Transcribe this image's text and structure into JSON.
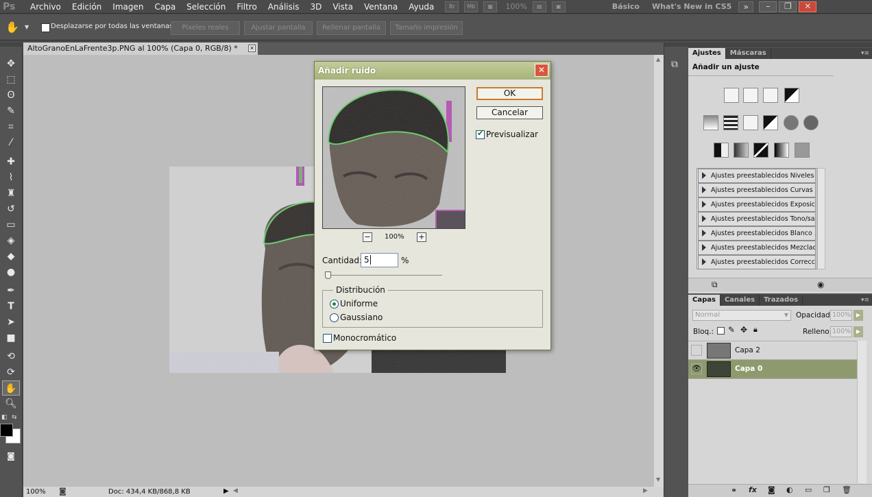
{
  "app": {
    "logo": "Ps"
  },
  "menu": [
    "Archivo",
    "Edición",
    "Imagen",
    "Capa",
    "Selección",
    "Filtro",
    "Análisis",
    "3D",
    "Vista",
    "Ventana",
    "Ayuda"
  ],
  "menubar": {
    "bridge_label": "Br",
    "minibridge_label": "Mb",
    "zoom_value": "100%",
    "workspace_basic": "Básico",
    "workspace_new": "What's New in CS5",
    "more_label": "»"
  },
  "options": {
    "scroll_all_label": "Desplazarse por todas las ventanas",
    "scroll_all_checked": false,
    "actual_pixels": "Píxeles reales",
    "fit_screen": "Ajustar pantalla",
    "fill_screen": "Rellenar pantalla",
    "print_size": "Tamaño impresión"
  },
  "document": {
    "tab_title": "AltoGranoEnLaFrente3p.PNG al 100% (Capa 0, RGB/8) *",
    "status_zoom": "100%",
    "status_doc": "Doc: 434,4 KB/868,8 KB"
  },
  "dialog": {
    "title": "Añadir ruido",
    "ok": "OK",
    "cancel": "Cancelar",
    "preview_label": "Previsualizar",
    "preview_checked": true,
    "preview_zoom": "100%",
    "zoom_out": "−",
    "zoom_in": "+",
    "amount_label": "Cantidad:",
    "amount_value": "5",
    "amount_unit": "%",
    "distribution_label": "Distribución",
    "uniform": "Uniforme",
    "gaussian": "Gaussiano",
    "distribution_selected": "Uniforme",
    "mono_label": "Monocromático",
    "mono_checked": false
  },
  "adjustments": {
    "tabs": [
      "Ajustes",
      "Máscaras"
    ],
    "active_tab": "Ajustes",
    "heading": "Añadir un ajuste",
    "presets": [
      "Ajustes preestablecidos Niveles",
      "Ajustes preestablecidos Curvas",
      "Ajustes preestablecidos Exposici...",
      "Ajustes preestablecidos Tono/sa...",
      "Ajustes preestablecidos Blanco ...",
      "Ajustes preestablecidos Mezclad...",
      "Ajustes preestablecidos Correcci..."
    ]
  },
  "layers": {
    "tabs": [
      "Capas",
      "Canales",
      "Trazados"
    ],
    "active_tab": "Capas",
    "blend_mode": "Normal",
    "opacity_label": "Opacidad:",
    "opacity_value": "100%",
    "lock_label": "Bloq.:",
    "fill_label": "Relleno:",
    "fill_value": "100%",
    "items": [
      {
        "name": "Capa 2",
        "visible": false,
        "selected": false
      },
      {
        "name": "Capa 0",
        "visible": true,
        "selected": true
      }
    ]
  },
  "colors": {
    "ui_dark": "#535353",
    "panel_light": "#d6d6d6",
    "dialog_title": "#a7b27a",
    "selected_layer": "#8e9a6e",
    "ok_border": "#c97b2e"
  }
}
